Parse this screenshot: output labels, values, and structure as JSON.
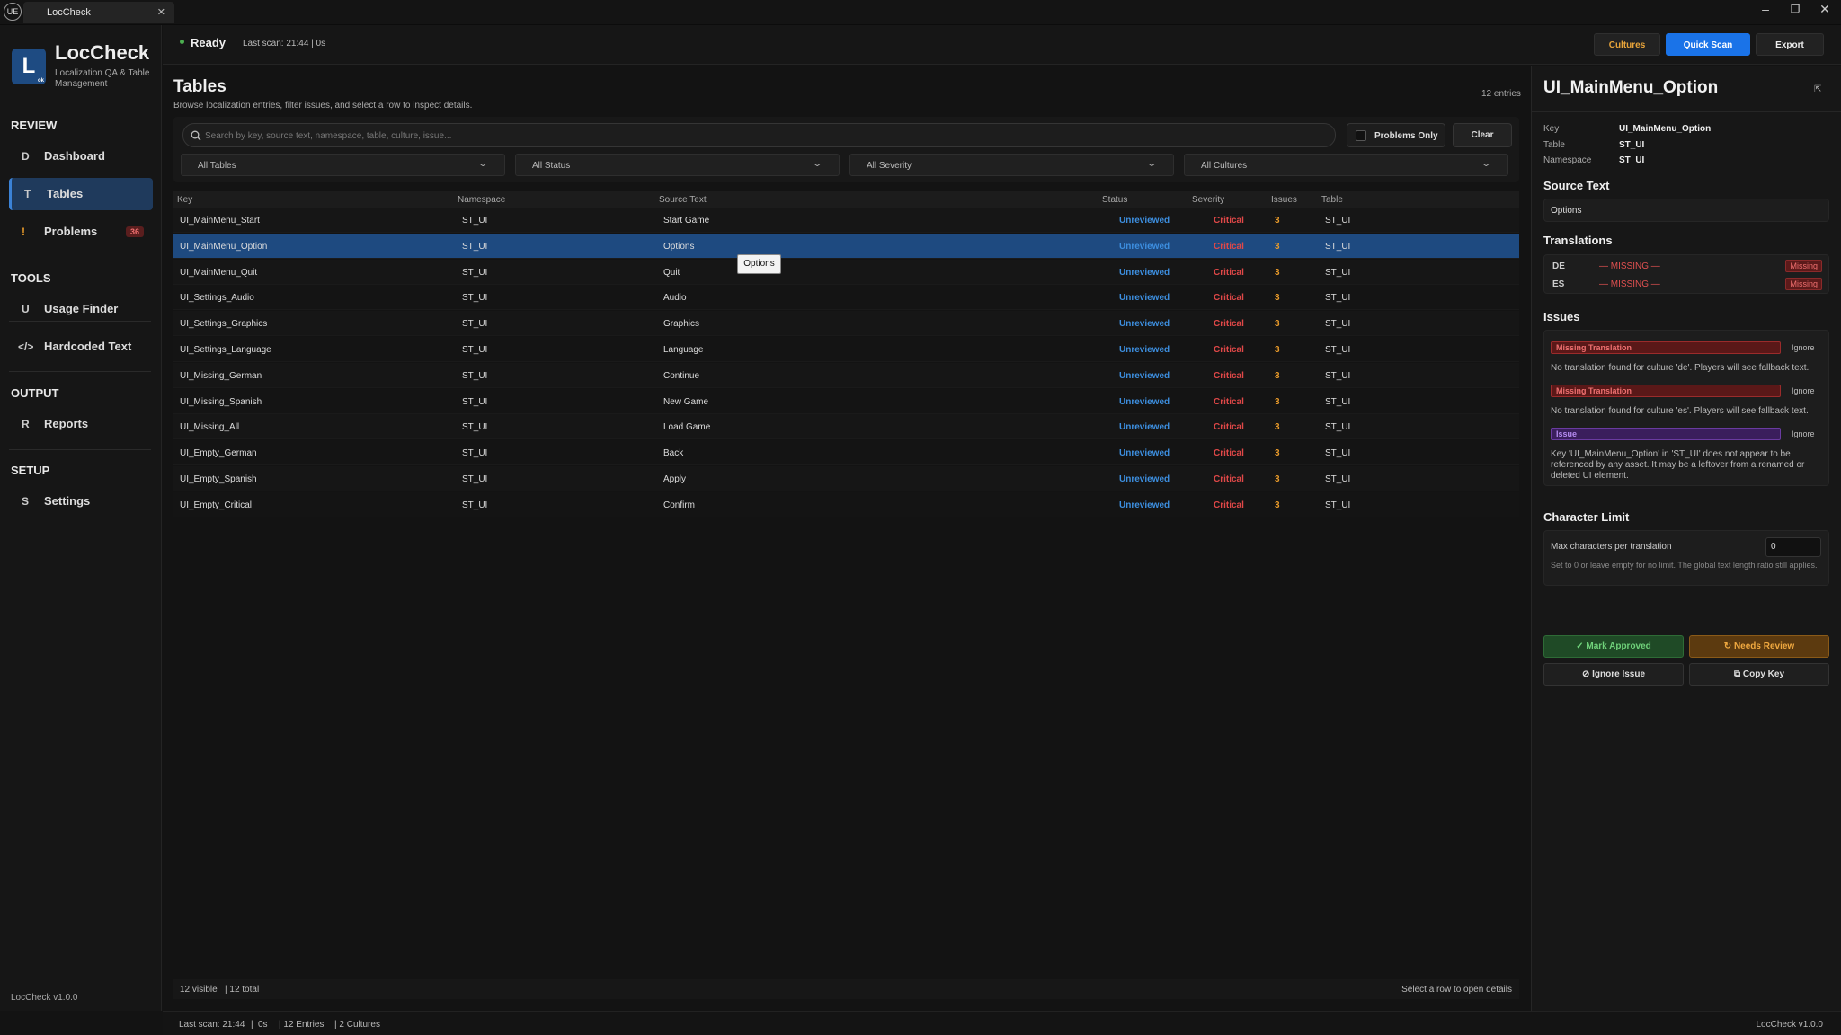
{
  "window": {
    "tab_title": "LocCheck",
    "logo_text": "UE"
  },
  "colors": {
    "accent": "#1a73e8",
    "selected_row": "#1e4a80",
    "status_unreviewed": "#3d8fe0",
    "severity_critical": "#e04848",
    "issues_count": "#e89a2a",
    "approve": "#4caf50",
    "review": "#e89a2a"
  },
  "sidebar": {
    "logo_letter": "L",
    "logo_sub": "ok",
    "app_title": "LocCheck",
    "app_subtitle": "Localization QA & Table Management",
    "sections": {
      "review": "REVIEW",
      "tools": "TOOLS",
      "output": "OUTPUT",
      "setup": "SETUP"
    },
    "items": [
      {
        "icon": "D",
        "label": "Dashboard"
      },
      {
        "icon": "T",
        "label": "Tables"
      },
      {
        "icon": "!",
        "label": "Problems",
        "badge": "36"
      },
      {
        "icon": "U",
        "label": "Usage Finder"
      },
      {
        "icon": "</>",
        "label": "Hardcoded Text"
      },
      {
        "icon": "R",
        "label": "Reports"
      },
      {
        "icon": "S",
        "label": "Settings"
      }
    ],
    "version": "LocCheck v1.0.0"
  },
  "topbar": {
    "status": "Ready",
    "last_scan": "Last scan: 21:44  |  0s",
    "buttons": {
      "cultures": "Cultures",
      "quick_scan": "Quick Scan",
      "export": "Export"
    }
  },
  "page": {
    "title": "Tables",
    "description": "Browse localization entries, filter issues, and select a row to inspect details.",
    "entries": "12 entries",
    "search_placeholder": "Search by key, source text, namespace, table, culture, issue...",
    "problems_only": "Problems Only",
    "clear": "Clear",
    "filters": [
      "All Tables",
      "All Status",
      "All Severity",
      "All Cultures"
    ],
    "columns": [
      "Key",
      "Namespace",
      "Source Text",
      "Status",
      "Severity",
      "Issues",
      "Table"
    ],
    "rows": [
      {
        "key": "UI_MainMenu_Start",
        "ns": "ST_UI",
        "src": "Start Game",
        "status": "Unreviewed",
        "sev": "Critical",
        "issues": "3",
        "table": "ST_UI"
      },
      {
        "key": "UI_MainMenu_Option",
        "ns": "ST_UI",
        "src": "Options",
        "status": "Unreviewed",
        "sev": "Critical",
        "issues": "3",
        "table": "ST_UI"
      },
      {
        "key": "UI_MainMenu_Quit",
        "ns": "ST_UI",
        "src": "Quit",
        "status": "Unreviewed",
        "sev": "Critical",
        "issues": "3",
        "table": "ST_UI"
      },
      {
        "key": "UI_Settings_Audio",
        "ns": "ST_UI",
        "src": "Audio",
        "status": "Unreviewed",
        "sev": "Critical",
        "issues": "3",
        "table": "ST_UI"
      },
      {
        "key": "UI_Settings_Graphics",
        "ns": "ST_UI",
        "src": "Graphics",
        "status": "Unreviewed",
        "sev": "Critical",
        "issues": "3",
        "table": "ST_UI"
      },
      {
        "key": "UI_Settings_Language",
        "ns": "ST_UI",
        "src": "Language",
        "status": "Unreviewed",
        "sev": "Critical",
        "issues": "3",
        "table": "ST_UI"
      },
      {
        "key": "UI_Missing_German",
        "ns": "ST_UI",
        "src": "Continue",
        "status": "Unreviewed",
        "sev": "Critical",
        "issues": "3",
        "table": "ST_UI"
      },
      {
        "key": "UI_Missing_Spanish",
        "ns": "ST_UI",
        "src": "New Game",
        "status": "Unreviewed",
        "sev": "Critical",
        "issues": "3",
        "table": "ST_UI"
      },
      {
        "key": "UI_Missing_All",
        "ns": "ST_UI",
        "src": "Load Game",
        "status": "Unreviewed",
        "sev": "Critical",
        "issues": "3",
        "table": "ST_UI"
      },
      {
        "key": "UI_Empty_German",
        "ns": "ST_UI",
        "src": "Back",
        "status": "Unreviewed",
        "sev": "Critical",
        "issues": "3",
        "table": "ST_UI"
      },
      {
        "key": "UI_Empty_Spanish",
        "ns": "ST_UI",
        "src": "Apply",
        "status": "Unreviewed",
        "sev": "Critical",
        "issues": "3",
        "table": "ST_UI"
      },
      {
        "key": "UI_Empty_Critical",
        "ns": "ST_UI",
        "src": "Confirm",
        "status": "Unreviewed",
        "sev": "Critical",
        "issues": "3",
        "table": "ST_UI"
      }
    ],
    "tooltip": "Options",
    "footer_visible": "12 visible",
    "footer_total": "| 12 total",
    "footer_hint": "Select a row to open details"
  },
  "statusbar": {
    "last_scan": "Last scan: 21:44",
    "dur": "0s",
    "entries": "| 12 Entries",
    "cultures": "| 2 Cultures",
    "version": "LocCheck v1.0.0"
  },
  "details": {
    "title": "UI_MainMenu_Option",
    "pin": "⇱",
    "key_label": "Key",
    "key_value": "UI_MainMenu_Option",
    "table_label": "Table",
    "table_value": "ST_UI",
    "ns_label": "Namespace",
    "ns_value": "ST_UI",
    "source_heading": "Source Text",
    "source_value": "Options",
    "translations_heading": "Translations",
    "translations": [
      {
        "culture": "DE",
        "text": "— MISSING —",
        "badge": "Missing"
      },
      {
        "culture": "ES",
        "text": "— MISSING —",
        "badge": "Missing"
      }
    ],
    "issues_heading": "Issues",
    "issues": [
      {
        "tag": "Missing Translation",
        "ignore": "Ignore",
        "text": "No translation found for culture 'de'. Players will see fallback text."
      },
      {
        "tag": "Missing Translation",
        "ignore": "Ignore",
        "text": "No translation found for culture 'es'. Players will see fallback text."
      },
      {
        "tag": "Issue",
        "ignore": "Ignore",
        "text": "Key 'UI_MainMenu_Option' in 'ST_UI' does not appear to be referenced by any asset. It may be a leftover from a renamed or deleted UI element."
      }
    ],
    "charlimit_heading": "Character Limit",
    "charlimit_label": "Max characters per translation",
    "charlimit_value": "0",
    "charlimit_hint": "Set to 0 or leave empty for no limit. The global text length ratio still applies.",
    "actions": {
      "approve": "✓ Mark Approved",
      "review": "↻ Needs Review",
      "ignore": "⊘ Ignore Issue",
      "copy": "⧉ Copy Key"
    }
  }
}
